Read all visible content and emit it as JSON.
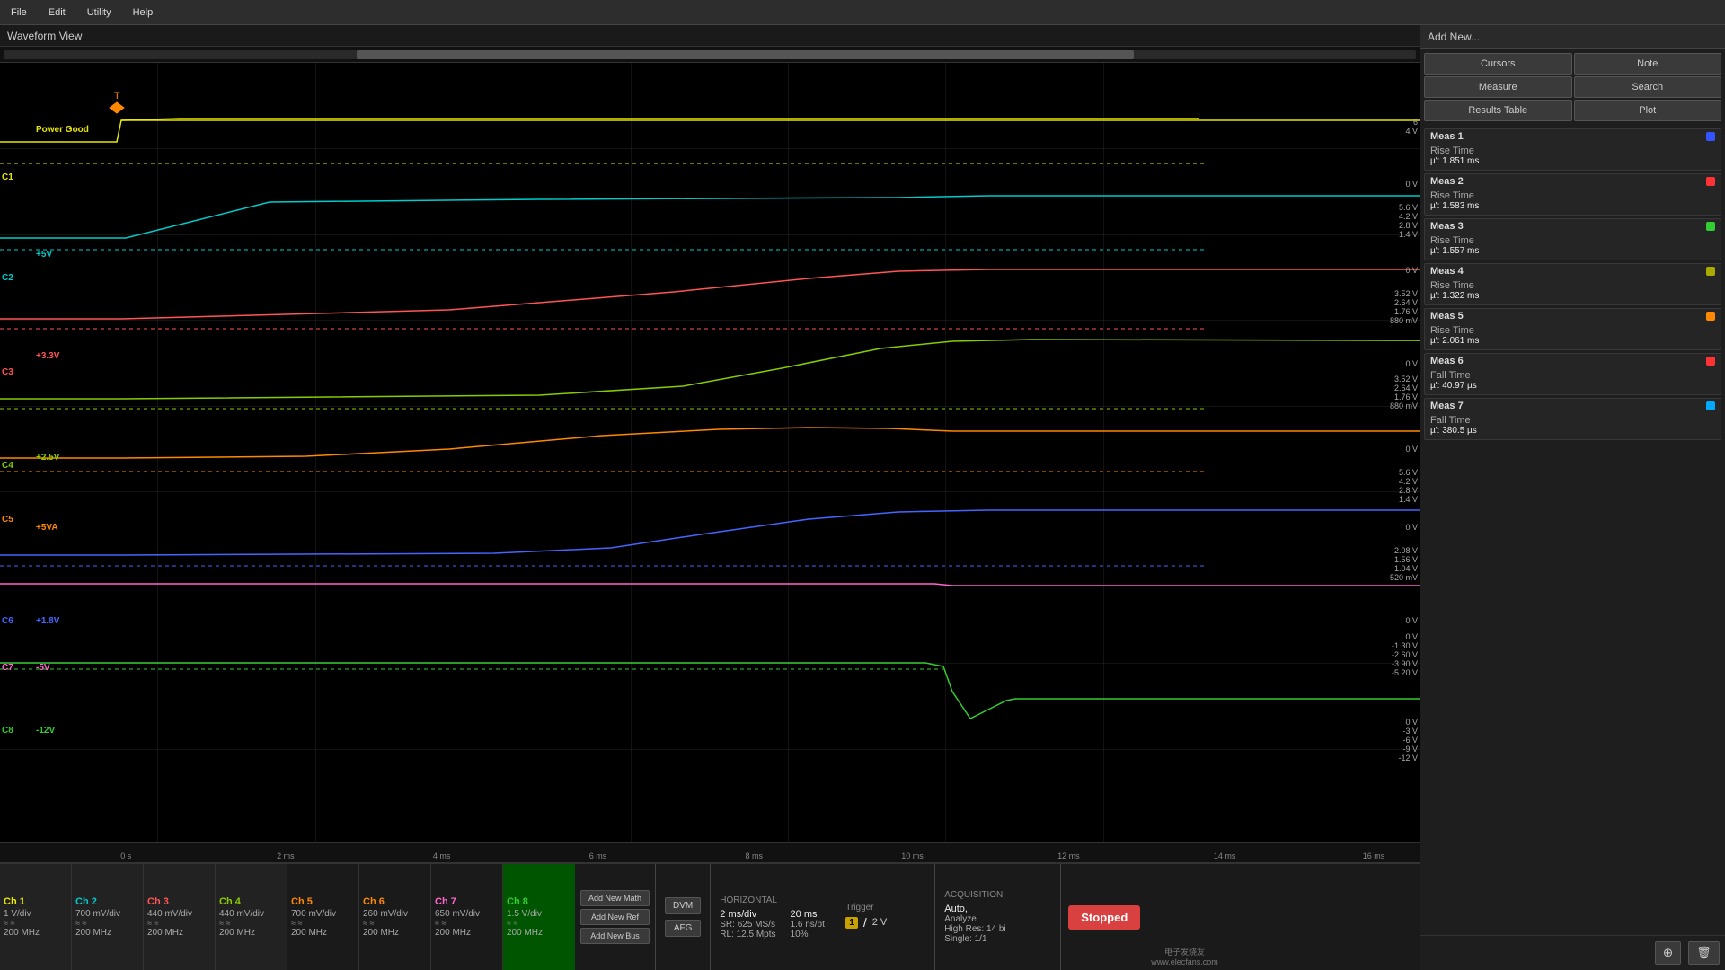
{
  "menu": {
    "items": [
      "File",
      "Edit",
      "Utility",
      "Help"
    ]
  },
  "waveform": {
    "title": "Waveform View",
    "scrollbar": {
      "left_pct": 25,
      "width_pct": 55
    }
  },
  "right_panel": {
    "add_new_label": "Add New...",
    "buttons": {
      "cursors": "Cursors",
      "note": "Note",
      "measure": "Measure",
      "search": "Search",
      "results_table": "Results Table",
      "plot": "Plot"
    }
  },
  "measurements": [
    {
      "id": "Meas 1",
      "color": "#3355ff",
      "type": "Rise Time",
      "value": "µ': 1.851 ms"
    },
    {
      "id": "Meas 2",
      "color": "#ff3333",
      "type": "Rise Time",
      "value": "µ': 1.583 ms"
    },
    {
      "id": "Meas 3",
      "color": "#33cc33",
      "type": "Rise Time",
      "value": "µ': 1.557 ms"
    },
    {
      "id": "Meas 4",
      "color": "#33cc33",
      "type": "Rise Time",
      "value": "µ': 1.322 ms"
    },
    {
      "id": "Meas 5",
      "color": "#ff8800",
      "type": "Rise Time",
      "value": "µ': 2.061 ms"
    },
    {
      "id": "Meas 6",
      "color": "#ff3333",
      "type": "Fall Time",
      "value": "µ': 40.97 µs"
    },
    {
      "id": "Meas 7",
      "color": "#00aaff",
      "type": "Fall Time",
      "value": "µ': 380.5 µs"
    }
  ],
  "channels": [
    {
      "name": "Ch 1",
      "color": "#e8e800",
      "param1": "1 V/div",
      "param2": "200 MHz"
    },
    {
      "name": "Ch 2",
      "color": "#00cccc",
      "param1": "700 mV/div",
      "param2": "200 MHz"
    },
    {
      "name": "Ch 3",
      "color": "#ff4444",
      "param1": "440 mV/div",
      "param2": "200 MHz"
    },
    {
      "name": "Ch 4",
      "color": "#88cc00",
      "param1": "440 mV/div",
      "param2": "200 MHz"
    },
    {
      "name": "Ch 5",
      "color": "#ff8800",
      "param1": "700 mV/div",
      "param2": "200 MHz"
    },
    {
      "name": "Ch 6",
      "color": "#ff8800",
      "param1": "260 mV/div",
      "param2": "200 MHz"
    },
    {
      "name": "Ch 7",
      "color": "#ff66cc",
      "param1": "650 mV/div",
      "param2": "200 MHz"
    },
    {
      "name": "Ch 8",
      "color": "#33cc33",
      "param1": "1.5 V/div",
      "param2": "200 MHz"
    }
  ],
  "instrument": {
    "add_math": "Add\nNew\nMath",
    "add_ref": "Add\nNew\nRef",
    "add_bus": "Add\nNew\nBus",
    "dvm": "DVM",
    "afg": "AFG",
    "horizontal": {
      "title": "Horizontal",
      "scale": "2 ms/div",
      "total": "20 ms",
      "sr": "SR: 625 MS/s",
      "rl": "RL: 12.5 Mpts",
      "ns_pt": "1.6 ns/pt",
      "pct": "10%"
    },
    "trigger": {
      "title": "Trigger",
      "ch": "1",
      "slope": "/",
      "level": "2 V"
    },
    "acquisition": {
      "title": "Acquisition",
      "mode": "Auto,",
      "analyze": "Analyze",
      "res": "High Res: 14 bi",
      "single": "Single: 1/1"
    }
  },
  "stopped": "Stopped",
  "watermark": "电子发烧友\nwww.elecfans.com",
  "time_labels": [
    "0 s",
    "2 ms",
    "4 ms",
    "6 ms",
    "8 ms",
    "10 ms",
    "12 ms",
    "14 ms",
    "16 ms"
  ],
  "signal_labels": [
    {
      "name": "Power Good",
      "y_pct": 12
    },
    {
      "name": "+5V",
      "y_pct": 28
    },
    {
      "name": "+3.3V",
      "y_pct": 41
    },
    {
      "name": "+2.5V",
      "y_pct": 54
    },
    {
      "name": "+5VA",
      "y_pct": 62
    },
    {
      "name": "+1.8V",
      "y_pct": 74
    },
    {
      "name": "-5V",
      "y_pct": 80
    },
    {
      "name": "-12V",
      "y_pct": 88
    }
  ]
}
